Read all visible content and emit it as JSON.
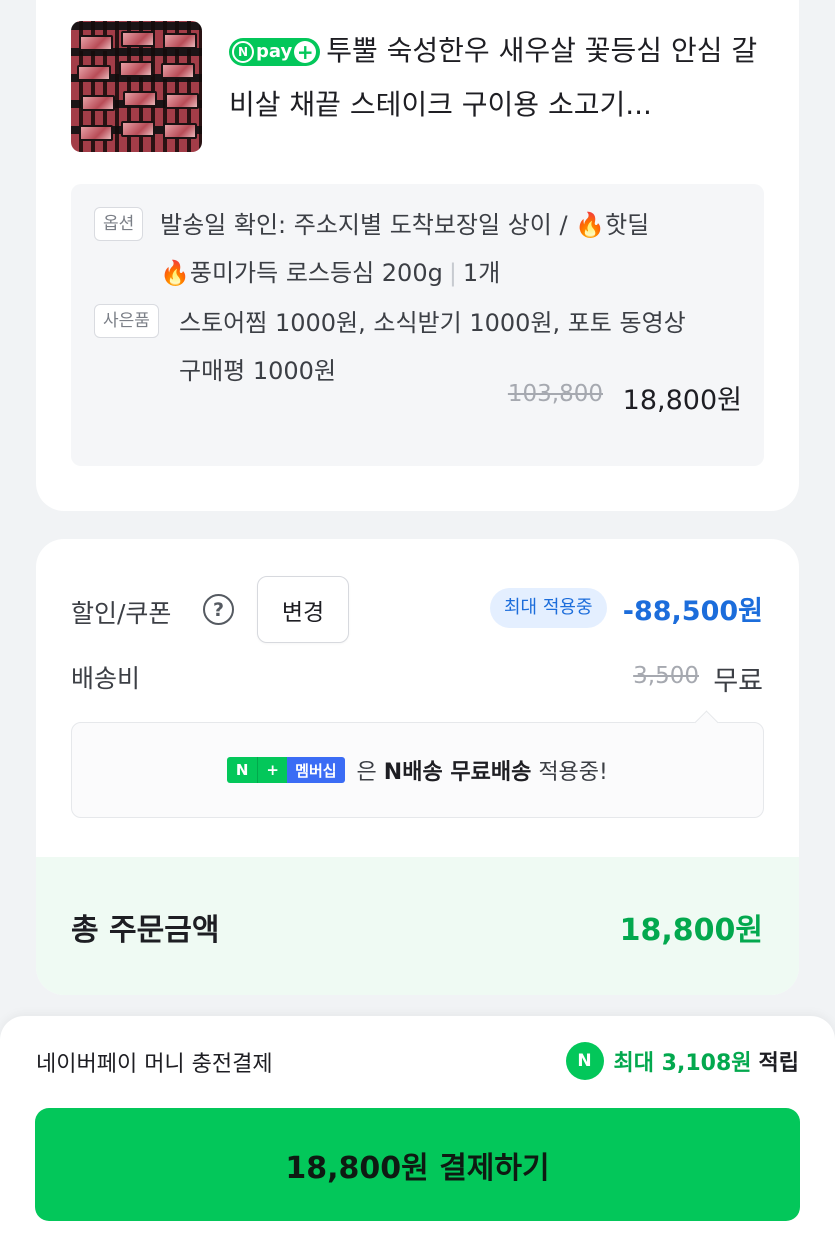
{
  "product": {
    "npay_badge": "pay",
    "title": "투뿔 숙성한우 새우살 꽃등심 안심 갈비살 채끝 스테이크 구이용 소고기...",
    "option_tag": "옵션",
    "option_text_line1": "발송일 확인: 주소지별 도착보장일 상이 / 🔥핫딜",
    "option_text_line2": "🔥풍미가득 로스등심 200g",
    "option_qty": "1개",
    "gift_tag": "사은품",
    "gift_text_line1": "스토어찜 1000원, 소식받기 1000원, 포토 동영상",
    "gift_text_line2": "구매평 1000원",
    "price_original": "103,800",
    "price_final": "18,800원"
  },
  "summary": {
    "discount_label": "할인/쿠폰",
    "change_button": "변경",
    "applied_badge": "최대 적용중",
    "discount_amount": "-88,500원",
    "shipping_label": "배송비",
    "shipping_original": "3,500",
    "shipping_final": "무료",
    "member_badge_n": "N",
    "member_badge_plus": "+",
    "member_badge_label": "멤버십",
    "notice_pre": "은",
    "notice_bold": "N배송 무료배송",
    "notice_post": "적용중!",
    "total_label": "총 주문금액",
    "total_amount": "18,800원"
  },
  "footer": {
    "pay_method": "네이버페이 머니 충전결제",
    "reward_icon": "N",
    "reward_prefix": "최대 3,108원",
    "reward_suffix": "적립",
    "pay_button": "18,800원 결제하기"
  },
  "colors": {
    "brand_green": "#03c75a",
    "discount_blue": "#1c6ddb",
    "total_green": "#03a84e"
  }
}
